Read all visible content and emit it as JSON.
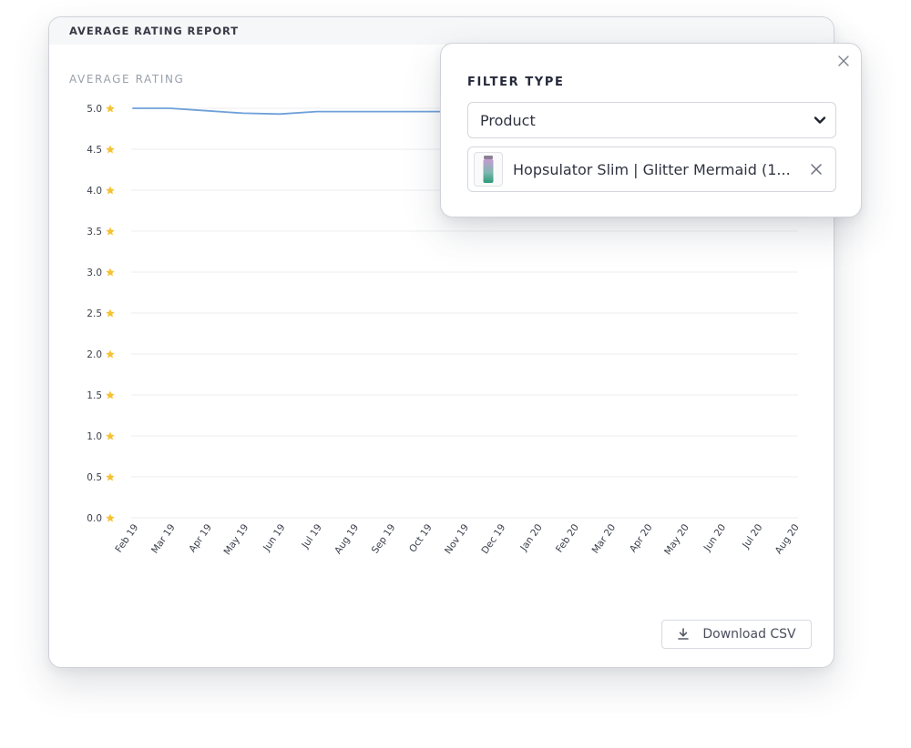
{
  "report": {
    "title": "AVERAGE RATING REPORT",
    "metric_label": "AVERAGE RATING"
  },
  "filter": {
    "title": "FILTER TYPE",
    "type_value": "Product",
    "selected_product": "Hopsulator Slim | Glitter Mermaid (1..."
  },
  "download": {
    "label": "Download CSV"
  },
  "colors": {
    "line": "#6ea0d8",
    "star": "#f5c234",
    "grid": "#eceef1"
  },
  "chart_data": {
    "type": "line",
    "x": [
      "Feb 19",
      "Mar 19",
      "Apr 19",
      "May 19",
      "Jun 19",
      "Jul 19",
      "Aug 19",
      "Sep 19",
      "Oct 19",
      "Nov 19",
      "Dec 19",
      "Jan 20",
      "Feb 20",
      "Mar 20",
      "Apr 20",
      "May 20",
      "Jun 20",
      "Jul 20",
      "Aug 20"
    ],
    "yticks": [
      "5.0",
      "4.5",
      "4.0",
      "3.5",
      "3.0",
      "2.5",
      "2.0",
      "1.5",
      "1.0",
      "0.5",
      "0.0"
    ],
    "series": [
      {
        "values": [
          5.0,
          5.0,
          4.97,
          4.94,
          4.93,
          4.96,
          4.96,
          4.96,
          4.96,
          4.96
        ]
      }
    ],
    "ylim": [
      0,
      5
    ],
    "ylabel": "AVERAGE RATING",
    "grid": true
  }
}
